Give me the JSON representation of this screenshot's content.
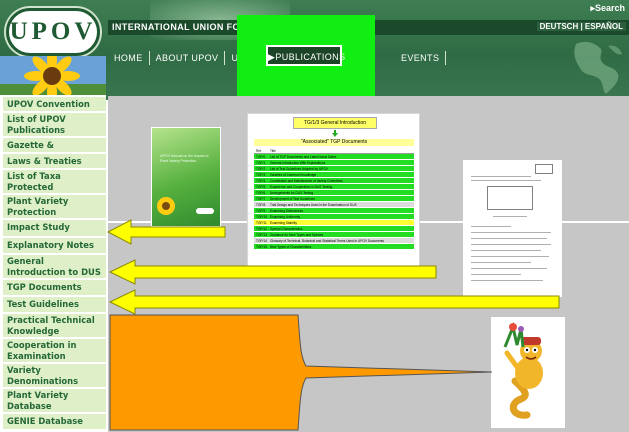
{
  "header": {
    "logo_text": "UPOV",
    "union_text": "INTERNATIONAL UNION FOR THE PROT",
    "languages": "DEUTSCH | ESPAÑOL",
    "search": "▸Search",
    "nav": [
      "HOME",
      "ABOUT UPOV",
      "UPOV DOC",
      "PUBLICATIONS",
      "EVENTS"
    ]
  },
  "sidebar": {
    "items": [
      "UPOV Convention",
      "List of UPOV Publications",
      "Gazette & Newsletter",
      "Laws & Treaties",
      "List of Taxa Protected",
      "Plant Variety Protection Statistics",
      "Impact Study",
      "Explanatory Notes",
      "General Introduction to DUS",
      "TGP Documents",
      "Test Guidelines",
      "Practical Technical Knowledge",
      "Cooperation in Examination",
      "Variety Denominations",
      "Plant Variety Database",
      "GENIE Database"
    ]
  },
  "tgp_doc": {
    "title": "TG/1/3 General Introduction",
    "subtitle": "\"Associated\" TGP Documents",
    "header_row": [
      "Ref.",
      "Title"
    ],
    "rows": [
      {
        "ref": "TGP/0",
        "title": "List of TGP Documents and Latest Issue Dates",
        "color": "#22dd22"
      },
      {
        "ref": "TGP/1",
        "title": "General Introduction With Explanations",
        "color": "#22dd22"
      },
      {
        "ref": "TGP/2",
        "title": "List of Test Guidelines Adopted by UPOV",
        "color": "#22dd22"
      },
      {
        "ref": "TGP/3",
        "title": "Varieties of Common Knowledge",
        "color": "#22dd22"
      },
      {
        "ref": "TGP/4",
        "title": "Constitution and Maintenance of Variety Collections",
        "color": "#22dd22"
      },
      {
        "ref": "TGP/5",
        "title": "Experience and Cooperation in DUS Testing",
        "color": "#22dd22"
      },
      {
        "ref": "TGP/6",
        "title": "Arrangements for DUS Testing",
        "color": "#22dd22"
      },
      {
        "ref": "TGP/7",
        "title": "Development of Test Guidelines",
        "color": "#22dd22"
      },
      {
        "ref": "TGP/8",
        "title": "Trial Design and Techniques Used in the Examination of DUS",
        "color": "#dcdcdc"
      },
      {
        "ref": "TGP/9",
        "title": "Examining Distinctness",
        "color": "#22dd22"
      },
      {
        "ref": "TGP/10",
        "title": "Examining Uniformity",
        "color": "#22dd22"
      },
      {
        "ref": "TGP/11",
        "title": "Examining Stability",
        "color": "#ffff33"
      },
      {
        "ref": "TGP/12",
        "title": "Special Characteristics",
        "color": "#22dd22"
      },
      {
        "ref": "TGP/13",
        "title": "Guidance for New Types and Species",
        "color": "#22dd22"
      },
      {
        "ref": "TGP/14",
        "title": "Glossary of Technical, Botanical and Statistical Terms Used in UPOV Documents",
        "color": "#dcdcdc"
      },
      {
        "ref": "TGP/15",
        "title": "New Types of Characteristics",
        "color": "#22dd22"
      }
    ]
  },
  "cover": {
    "text": "UPOV Manual on the Impact of Plant Variety Protection"
  },
  "colors": {
    "highlight_green": "#11ee11",
    "arrow_yellow": "#ffff00",
    "arrow_orange": "#ff9900",
    "sidebar_text": "#246838",
    "sidebar_bg": "#dff0c8"
  }
}
